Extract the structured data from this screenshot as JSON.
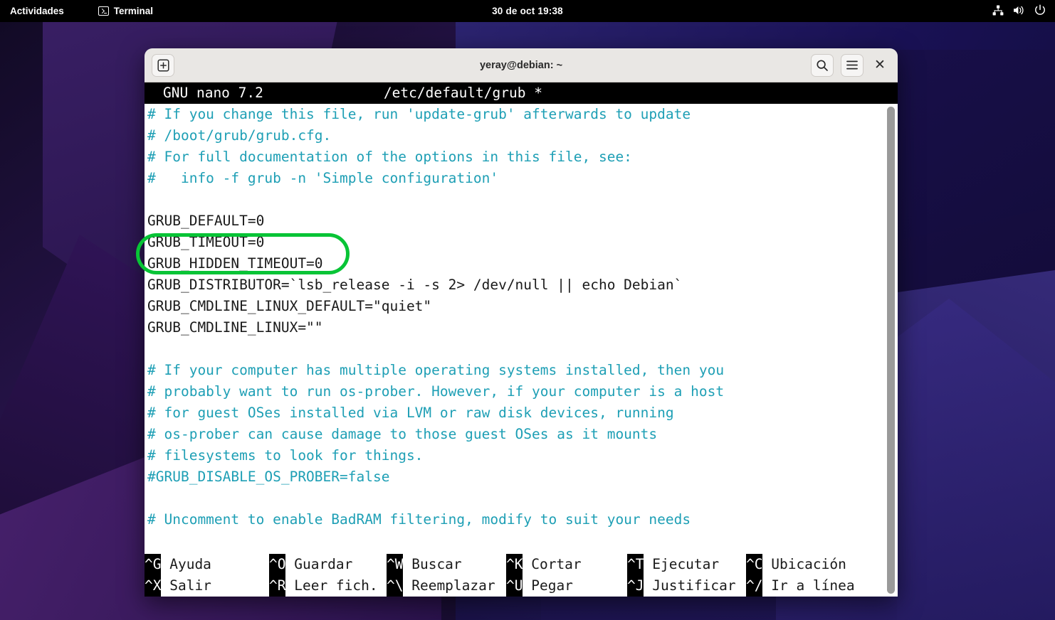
{
  "topbar": {
    "activities": "Actividades",
    "app_name": "Terminal",
    "app_icon": "terminal-icon",
    "clock": "30 de oct  19:38",
    "tray": [
      "network-wired-icon",
      "volume-icon",
      "power-icon"
    ]
  },
  "window": {
    "title": "yeray@debian: ~",
    "new_tab_icon": "add-tab-icon",
    "search_icon": "search-icon",
    "menu_icon": "hamburger-menu-icon",
    "close_icon": "close-icon"
  },
  "nano": {
    "version": "GNU nano 7.2",
    "filename": "/etc/default/grub *",
    "lines": [
      {
        "text": "# If you change this file, run 'update-grub' afterwards to update",
        "type": "comment"
      },
      {
        "text": "# /boot/grub/grub.cfg.",
        "type": "comment"
      },
      {
        "text": "# For full documentation of the options in this file, see:",
        "type": "comment"
      },
      {
        "text": "#   info -f grub -n 'Simple configuration'",
        "type": "comment"
      },
      {
        "text": "",
        "type": "blank"
      },
      {
        "text": "GRUB_DEFAULT=0",
        "type": "code"
      },
      {
        "text": "GRUB_TIMEOUT=0",
        "type": "code"
      },
      {
        "text": "GRUB_HIDDEN_TIMEOUT=0",
        "type": "code"
      },
      {
        "text": "GRUB_DISTRIBUTOR=`lsb_release -i -s 2> /dev/null || echo Debian`",
        "type": "code"
      },
      {
        "text": "GRUB_CMDLINE_LINUX_DEFAULT=\"quiet\"",
        "type": "code"
      },
      {
        "text": "GRUB_CMDLINE_LINUX=\"\"",
        "type": "code"
      },
      {
        "text": "",
        "type": "blank"
      },
      {
        "text": "# If your computer has multiple operating systems installed, then you",
        "type": "comment"
      },
      {
        "text": "# probably want to run os-prober. However, if your computer is a host",
        "type": "comment"
      },
      {
        "text": "# for guest OSes installed via LVM or raw disk devices, running",
        "type": "comment"
      },
      {
        "text": "# os-prober can cause damage to those guest OSes as it mounts",
        "type": "comment"
      },
      {
        "text": "# filesystems to look for things.",
        "type": "comment"
      },
      {
        "text": "#GRUB_DISABLE_OS_PROBER=false",
        "type": "comment"
      },
      {
        "text": "",
        "type": "blank"
      },
      {
        "text": "# Uncomment to enable BadRAM filtering, modify to suit your needs",
        "type": "comment"
      }
    ],
    "shortcuts_row1": [
      {
        "key": "^G",
        "label": "Ayuda"
      },
      {
        "key": "^O",
        "label": "Guardar"
      },
      {
        "key": "^W",
        "label": "Buscar"
      },
      {
        "key": "^K",
        "label": "Cortar"
      },
      {
        "key": "^T",
        "label": "Ejecutar"
      },
      {
        "key": "^C",
        "label": "Ubicación"
      }
    ],
    "shortcuts_row2": [
      {
        "key": "^X",
        "label": "Salir"
      },
      {
        "key": "^R",
        "label": "Leer fich."
      },
      {
        "key": "^\\",
        "label": "Reemplazar"
      },
      {
        "key": "^U",
        "label": "Pegar"
      },
      {
        "key": "^J",
        "label": "Justificar"
      },
      {
        "key": "^/",
        "label": "Ir a línea"
      }
    ]
  },
  "annotation": {
    "shape": "rounded-rectangle-highlight",
    "color": "#08c436",
    "targets": [
      "GRUB_TIMEOUT=0",
      "GRUB_HIDDEN_TIMEOUT=0"
    ]
  },
  "colors": {
    "comment_text": "#1e9fb5",
    "code_text": "#1a1a1a",
    "terminal_bg": "#ffffff",
    "nano_bar_bg": "#000000",
    "titlebar_bg": "#e9e7e4",
    "annotation_green": "#08c436"
  }
}
